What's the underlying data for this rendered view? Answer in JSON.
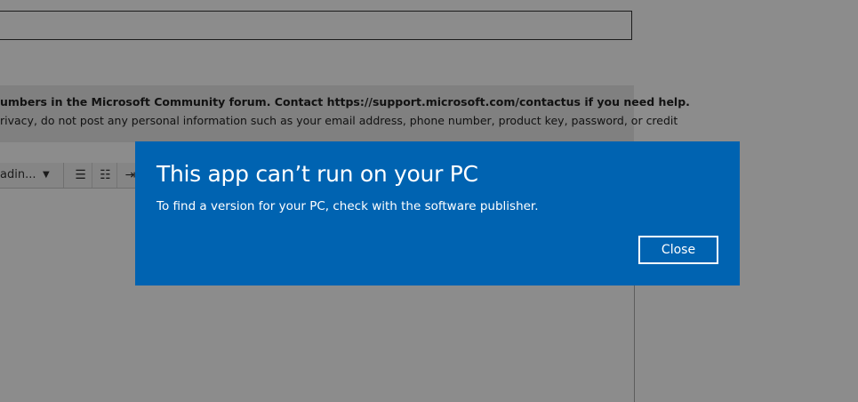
{
  "background": {
    "notice": {
      "line1": "umbers in the Microsoft Community forum. Contact https://support.microsoft.com/contactus if you need help.",
      "line2": "rivacy, do not post any personal information such as your email address, phone number, product key, password, or credit"
    },
    "toolbar": {
      "heading_select_value": "adin...",
      "heading_caret": "▼",
      "bulleted_list_icon": "☰",
      "numbered_list_icon": "☷",
      "indent_icon": "⇥"
    }
  },
  "dialog": {
    "title": "This app can’t run on your PC",
    "message": "To find a version for your PC, check with the software publisher.",
    "close_label": "Close",
    "bg_color": "#0063b1"
  }
}
